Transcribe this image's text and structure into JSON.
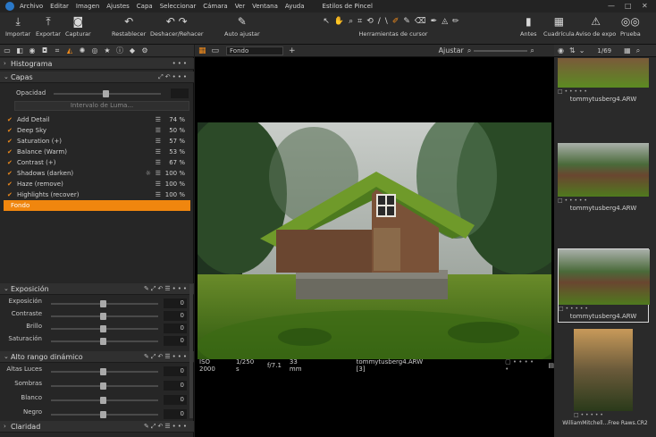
{
  "menubar": {
    "items": [
      "Archivo",
      "Editar",
      "Imagen",
      "Ajustes",
      "Capa",
      "Seleccionar",
      "Cámara",
      "Ver",
      "Ventana",
      "Ayuda"
    ],
    "title": "Estilos de Pincel"
  },
  "toolbar": {
    "importar": "Importar",
    "exportar": "Exportar",
    "capturar": "Capturar",
    "restablecer": "Restablecer",
    "deshacer": "Deshacer/Rehacer",
    "auto_ajustar": "Auto ajustar",
    "herramientas": "Herramientas de cursor",
    "antes": "Antes",
    "cuadricula": "Cuadrícula",
    "aviso": "Aviso de expo",
    "prueba": "Prueba"
  },
  "histograma": {
    "title": "Histograma"
  },
  "capas": {
    "title": "Capas",
    "opacidad_label": "Opacidad",
    "intervalo_button": "Intervalo de Luma...",
    "layers": [
      {
        "name": "Add Detail",
        "value": "74 %"
      },
      {
        "name": "Deep Sky",
        "value": "50 %"
      },
      {
        "name": "Saturation (+)",
        "value": "57 %"
      },
      {
        "name": "Balance (Warm)",
        "value": "53 %"
      },
      {
        "name": "Contrast (+)",
        "value": "67 %"
      },
      {
        "name": "Shadows (darken)",
        "value": "100 %"
      },
      {
        "name": "Haze (remove)",
        "value": "100 %"
      },
      {
        "name": "Highlights (recover)",
        "value": "100 %"
      }
    ],
    "selected_layer": "Fondo"
  },
  "exposicion": {
    "title": "Exposición",
    "sliders": [
      {
        "name": "Exposición",
        "value": "0"
      },
      {
        "name": "Contraste",
        "value": "0"
      },
      {
        "name": "Brillo",
        "value": "0"
      },
      {
        "name": "Saturación",
        "value": "0"
      }
    ]
  },
  "hdr": {
    "title": "Alto rango dinámico",
    "sliders": [
      {
        "name": "Altas Luces",
        "value": "0"
      },
      {
        "name": "Sombras",
        "value": "0"
      },
      {
        "name": "Blanco",
        "value": "0"
      },
      {
        "name": "Negro",
        "value": "0"
      }
    ]
  },
  "claridad": {
    "title": "Claridad"
  },
  "viewer": {
    "layer_select": "Fondo",
    "ajustar_label": "Ajustar",
    "iso": "ISO 2000",
    "shutter": "1/250 s",
    "aperture": "f/7.1",
    "focal": "33 mm",
    "filename": "tommytusberg4.ARW [3]"
  },
  "browser": {
    "counter": "1/69",
    "thumbnails": [
      {
        "name": "tommytusberg4.ARW"
      },
      {
        "name": "tommytusberg4.ARW"
      },
      {
        "name": "tommytusberg4.ARW"
      },
      {
        "name": "WilliamMitchell...Free Raws.CR2"
      }
    ]
  },
  "colors": {
    "accent": "#f0860e",
    "panel": "#262626",
    "viewer_bg": "#000000"
  }
}
